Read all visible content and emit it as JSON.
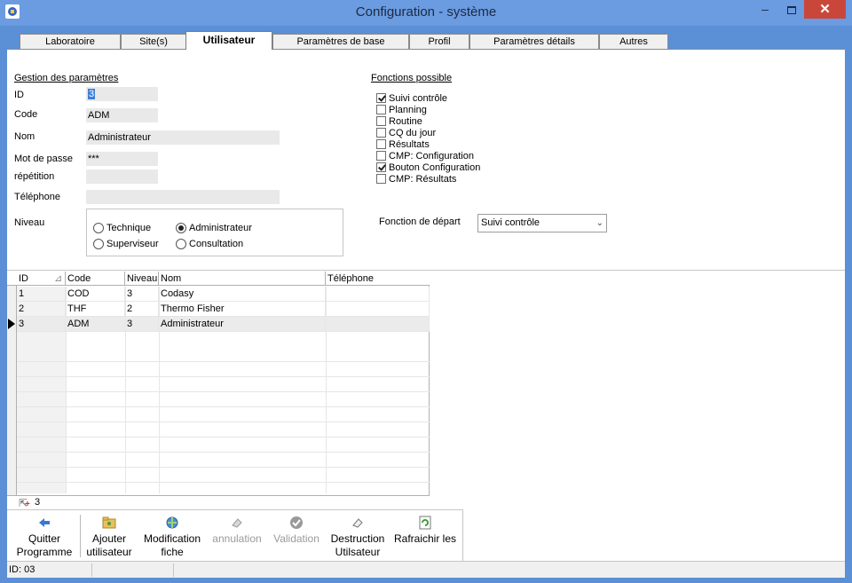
{
  "window": {
    "title": "Configuration - système",
    "minimize": "–",
    "close": "✕"
  },
  "tabs": [
    {
      "label": "Laboratoire"
    },
    {
      "label": "Site(s)"
    },
    {
      "label": "Utilisateur",
      "active": true
    },
    {
      "label": "Paramètres de base"
    },
    {
      "label": "Profil"
    },
    {
      "label": "Paramètres détails"
    },
    {
      "label": "Autres"
    }
  ],
  "form": {
    "section_title": "Gestion des paramètres",
    "id_label": "ID",
    "id_value": "3",
    "code_label": "Code",
    "code_value": "ADM",
    "nom_label": "Nom",
    "nom_value": "Administrateur",
    "password_label": "Mot de passe",
    "password_value": "***",
    "repeat_label": "répétition",
    "repeat_value": "",
    "phone_label": "Téléphone",
    "phone_value": "",
    "niveau_label": "Niveau",
    "niveau_options": [
      {
        "label": "Technique",
        "selected": false
      },
      {
        "label": "Administrateur",
        "selected": true
      },
      {
        "label": "Superviseur",
        "selected": false
      },
      {
        "label": "Consultation",
        "selected": false
      }
    ]
  },
  "functions": {
    "title": "Fonctions possible",
    "items": [
      {
        "label": "Suivi contrôle",
        "checked": true
      },
      {
        "label": "Planning",
        "checked": false
      },
      {
        "label": "Routine",
        "checked": false
      },
      {
        "label": "CQ du jour",
        "checked": false
      },
      {
        "label": "Résultats",
        "checked": false
      },
      {
        "label": "CMP: Configuration",
        "checked": false
      },
      {
        "label": "Bouton Configuration",
        "checked": true
      },
      {
        "label": "CMP: Résultats",
        "checked": false
      }
    ],
    "start_label": "Fonction de départ",
    "start_value": "Suivi contrôle"
  },
  "grid": {
    "columns": [
      "ID",
      "Code",
      "Niveau",
      "Nom",
      "Téléphone"
    ],
    "rows": [
      {
        "id": "1",
        "code": "COD",
        "niveau": "3",
        "nom": "Codasy",
        "telephone": ""
      },
      {
        "id": "2",
        "code": "THF",
        "niveau": "2",
        "nom": "Thermo Fisher",
        "telephone": ""
      },
      {
        "id": "3",
        "code": "ADM",
        "niveau": "3",
        "nom": "Administrateur",
        "telephone": ""
      }
    ],
    "current_row": 2,
    "record_count": "3"
  },
  "toolbar": {
    "quit": "Quitter Programme",
    "add": "Ajouter utilisateur",
    "modify": "Modification fiche",
    "cancel": "annulation",
    "validate": "Validation",
    "destroy": "Destruction Utilsateur",
    "refresh": "Rafraichir les"
  },
  "status": {
    "text": "ID: 03"
  },
  "colors": {
    "titlebar": "#6b9be0",
    "frame": "#5b8fd6",
    "close": "#c9473a",
    "selection": "#3d7fd8"
  }
}
